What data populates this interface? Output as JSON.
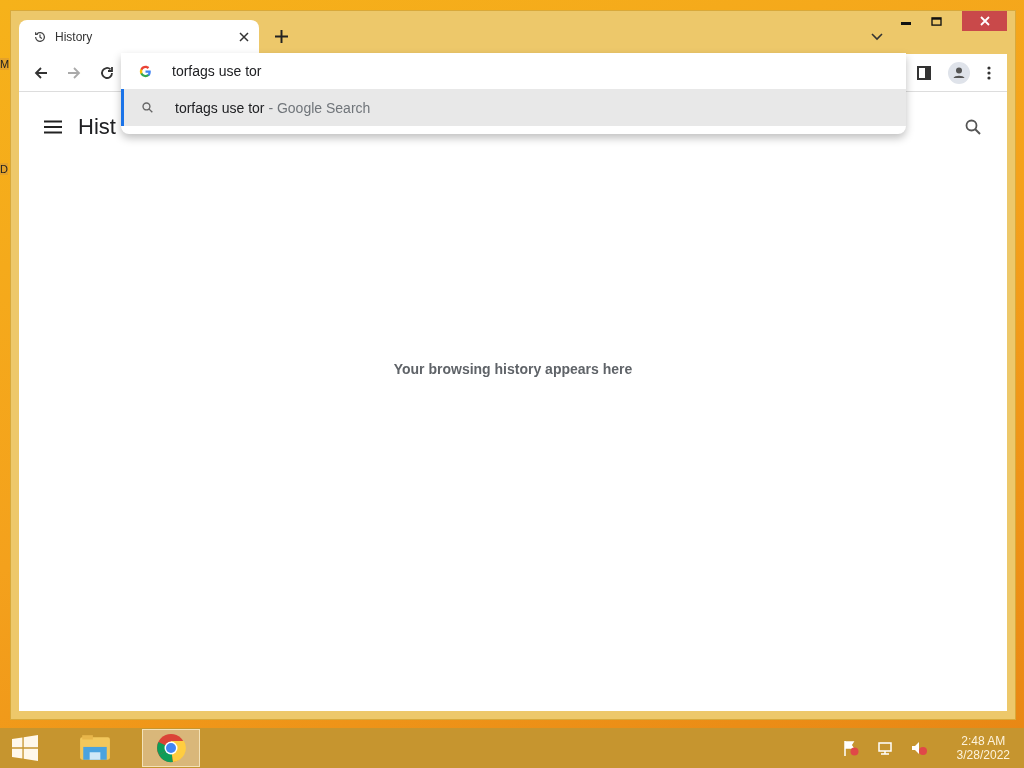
{
  "desktop": {
    "icon_labels": [
      "M",
      "D"
    ]
  },
  "window": {
    "tabs": [
      {
        "title": "History",
        "selected": true
      }
    ]
  },
  "omnibox": {
    "value": "torfags use tor",
    "suggestions": [
      {
        "text": "torfags use tor",
        "hint": "- Google Search",
        "selected": true
      }
    ]
  },
  "page": {
    "title": "Hist",
    "empty_message": "Your browsing history appears here"
  },
  "taskbar": {
    "apps": [
      {
        "kind": "explorer",
        "selected": false
      },
      {
        "kind": "chrome",
        "selected": true
      }
    ],
    "time": "2:48 AM",
    "date": "3/28/2022"
  }
}
